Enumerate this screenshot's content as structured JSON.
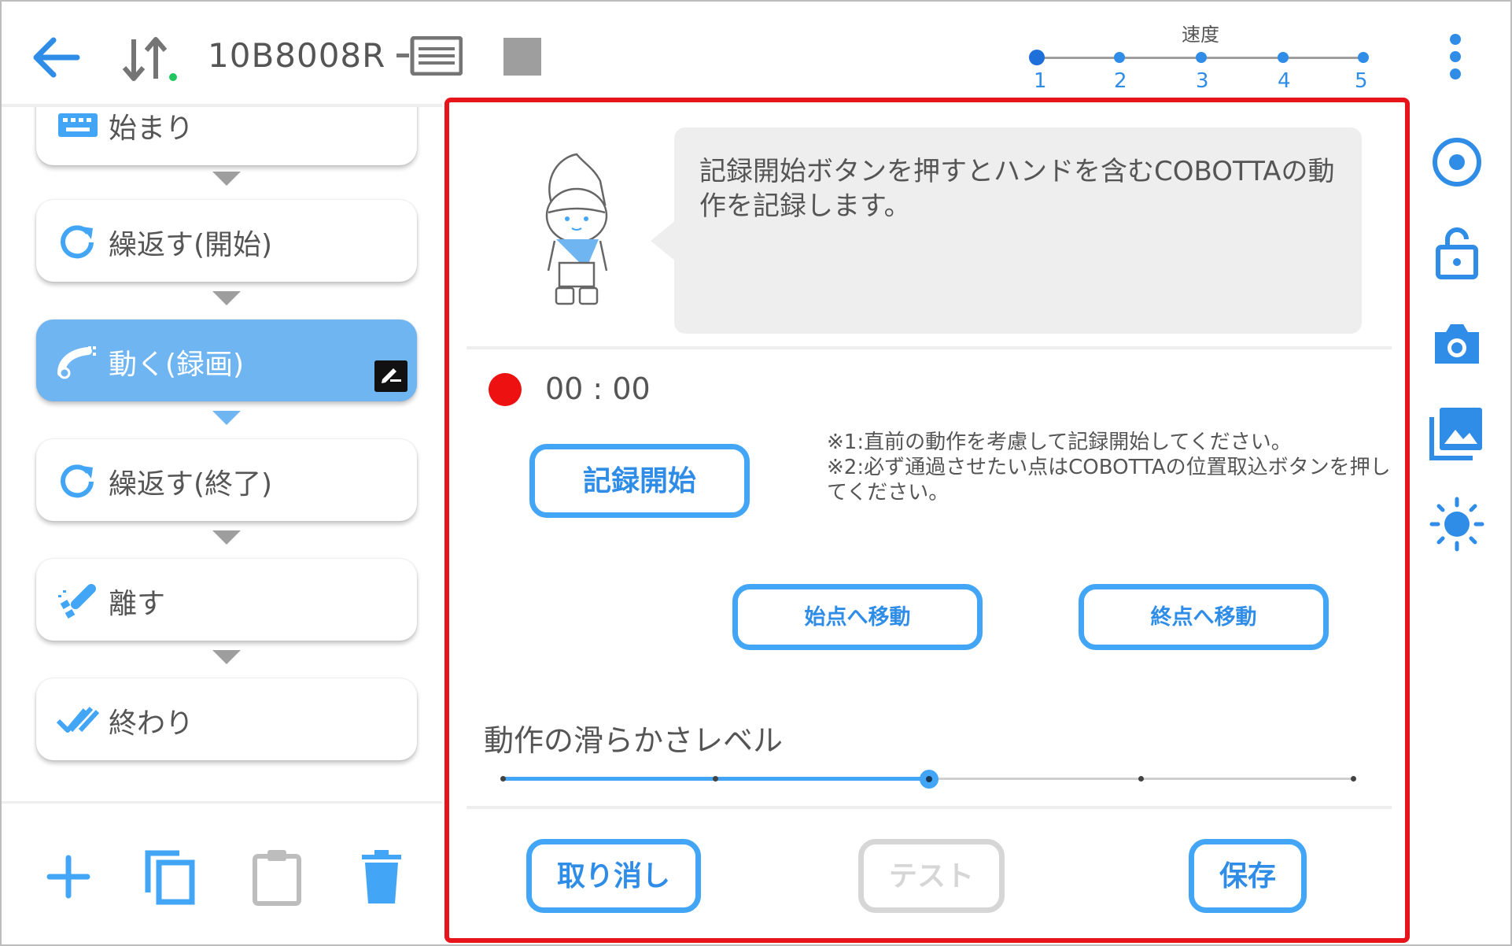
{
  "header": {
    "device_id": "10B8008R",
    "speed": {
      "label": "速度",
      "levels": [
        "1",
        "2",
        "3",
        "4",
        "5"
      ],
      "selected": 1
    }
  },
  "flow": {
    "items": [
      {
        "label": "始まり",
        "icon": "keyboard-icon"
      },
      {
        "label": "繰返す(開始)",
        "icon": "repeat-icon"
      },
      {
        "label": "動く(録画)",
        "icon": "robot-arm-move-icon",
        "selected": true
      },
      {
        "label": "繰返す(終了)",
        "icon": "repeat-icon"
      },
      {
        "label": "離す",
        "icon": "gripper-release-icon"
      },
      {
        "label": "終わり",
        "icon": "double-check-icon"
      }
    ]
  },
  "panel": {
    "message": "記録開始ボタンを押すとハンドを含むCOBOTTAの動作を記録します。",
    "record_time": "00 : 00",
    "record_button": "記録開始",
    "note_1": "※1:直前の動作を考慮して記録開始してください。",
    "note_2": "※2:必ず通過させたい点はCOBOTTAの位置取込ボタンを押してください。",
    "move_start_button": "始点へ移動",
    "move_end_button": "終点へ移動",
    "smoothness": {
      "label": "動作の滑らかさレベル",
      "levels": 5,
      "value": 3
    },
    "cancel_button": "取り消し",
    "test_button": "テスト",
    "save_button": "保存"
  },
  "colors": {
    "accent": "#42a5f5",
    "selected_item": "#6fb5f2",
    "record": "#ee1111",
    "highlight_border": "#e8141b",
    "disabled": "#d6d6d6"
  }
}
